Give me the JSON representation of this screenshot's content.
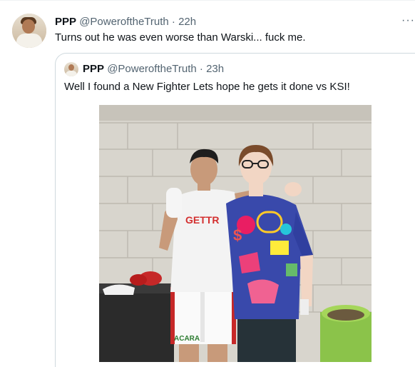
{
  "tweet": {
    "name": "PPP",
    "handle": "@PoweroftheTruth",
    "dot": "·",
    "time": "22h",
    "more": "···",
    "text": "Turns out he was even worse than Warski... fuck me."
  },
  "quoted": {
    "name": "PPP",
    "handle": "@PoweroftheTruth",
    "dot": "·",
    "time": "23h",
    "text": "Well I found a New Fighter Lets hope he gets it done vs KSI!",
    "photo": {
      "shirt_text": "GETTR",
      "shorts_text": "ACARA"
    }
  }
}
